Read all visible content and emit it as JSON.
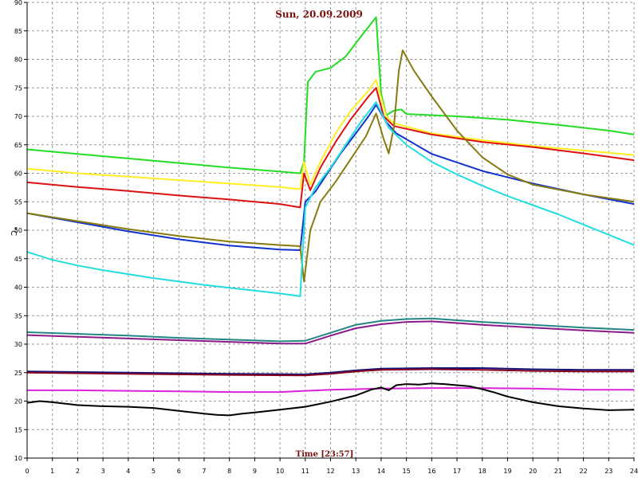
{
  "chart_data": {
    "type": "line",
    "title": "Sun, 20.09.2009",
    "xlabel": "Time [23:57]",
    "ylabel": "°C",
    "xlim": [
      0,
      24
    ],
    "ylim": [
      10,
      90
    ],
    "xticks": [
      "0",
      "1",
      "2",
      "3",
      "4",
      "5",
      "6",
      "7",
      "8",
      "9",
      "10",
      "11",
      "12",
      "13",
      "14",
      "15",
      "16",
      "17",
      "18",
      "19",
      "20",
      "21",
      "22",
      "23",
      "24"
    ],
    "yticks": [
      "10",
      "15",
      "20",
      "25",
      "30",
      "35",
      "40",
      "45",
      "50",
      "55",
      "60",
      "65",
      "70",
      "75",
      "80",
      "85",
      "90"
    ],
    "grid": true,
    "series": [
      {
        "color": "#22dd22",
        "points": [
          [
            0,
            64.2
          ],
          [
            2,
            63.4
          ],
          [
            4,
            62.6
          ],
          [
            6,
            61.8
          ],
          [
            8,
            61.0
          ],
          [
            10,
            60.3
          ],
          [
            10.8,
            60.0
          ],
          [
            10.95,
            62
          ],
          [
            11.1,
            76
          ],
          [
            11.4,
            77.8
          ],
          [
            12,
            78.5
          ],
          [
            12.6,
            80.5
          ],
          [
            13.2,
            84
          ],
          [
            13.8,
            87.4
          ],
          [
            14.0,
            74
          ],
          [
            14.2,
            70.2
          ],
          [
            14.5,
            71.0
          ],
          [
            14.8,
            71.2
          ],
          [
            15,
            70.4
          ],
          [
            17,
            70.0
          ],
          [
            19,
            69.4
          ],
          [
            21,
            68.5
          ],
          [
            23,
            67.5
          ],
          [
            24,
            66.8
          ]
        ]
      },
      {
        "color": "#ffee22",
        "points": [
          [
            0,
            60.8
          ],
          [
            2,
            60.0
          ],
          [
            4,
            59.4
          ],
          [
            6,
            58.8
          ],
          [
            8,
            58.2
          ],
          [
            10,
            57.6
          ],
          [
            10.8,
            57.2
          ],
          [
            10.95,
            62
          ],
          [
            11.2,
            58
          ],
          [
            11.6,
            62
          ],
          [
            12.2,
            67
          ],
          [
            12.8,
            71
          ],
          [
            13.5,
            74.5
          ],
          [
            13.8,
            76.4
          ],
          [
            14.2,
            70
          ],
          [
            14.5,
            68.8
          ],
          [
            16,
            67.0
          ],
          [
            18,
            65.8
          ],
          [
            20,
            64.8
          ],
          [
            22,
            64.0
          ],
          [
            24,
            63.2
          ]
        ]
      },
      {
        "color": "#dd1111",
        "points": [
          [
            0,
            58.4
          ],
          [
            2,
            57.6
          ],
          [
            4,
            56.9
          ],
          [
            6,
            56.1
          ],
          [
            8,
            55.4
          ],
          [
            10,
            54.6
          ],
          [
            10.8,
            54.0
          ],
          [
            10.95,
            60
          ],
          [
            11.2,
            57
          ],
          [
            11.6,
            61
          ],
          [
            12.2,
            65.5
          ],
          [
            12.8,
            69.5
          ],
          [
            13.5,
            73.5
          ],
          [
            13.8,
            75.0
          ],
          [
            14.1,
            70
          ],
          [
            14.5,
            68.3
          ],
          [
            16,
            66.8
          ],
          [
            18,
            65.5
          ],
          [
            20,
            64.6
          ],
          [
            22,
            63.5
          ],
          [
            24,
            62.3
          ]
        ]
      },
      {
        "color": "#1133cc",
        "points": [
          [
            0,
            53.0
          ],
          [
            2,
            51.4
          ],
          [
            4,
            49.8
          ],
          [
            6,
            48.4
          ],
          [
            8,
            47.3
          ],
          [
            10,
            46.6
          ],
          [
            10.8,
            46.5
          ],
          [
            11.0,
            55
          ],
          [
            11.4,
            56.8
          ],
          [
            11.8,
            59.5
          ],
          [
            12.4,
            63.5
          ],
          [
            13.0,
            67
          ],
          [
            13.5,
            70
          ],
          [
            13.8,
            72
          ],
          [
            14.2,
            69
          ],
          [
            14.6,
            67.0
          ],
          [
            16,
            63.4
          ],
          [
            18,
            60.4
          ],
          [
            20,
            58.2
          ],
          [
            22,
            56.3
          ],
          [
            24,
            54.6
          ]
        ]
      },
      {
        "color": "#877a10",
        "points": [
          [
            0,
            53.0
          ],
          [
            2,
            51.6
          ],
          [
            4,
            50.2
          ],
          [
            6,
            49.0
          ],
          [
            8,
            48.0
          ],
          [
            10,
            47.4
          ],
          [
            10.8,
            47.2
          ],
          [
            10.95,
            41
          ],
          [
            11.2,
            50
          ],
          [
            11.6,
            55
          ],
          [
            12.2,
            58.5
          ],
          [
            12.8,
            62.5
          ],
          [
            13.4,
            66.5
          ],
          [
            13.8,
            70.5
          ],
          [
            14.1,
            66
          ],
          [
            14.3,
            63.5
          ],
          [
            14.5,
            68
          ],
          [
            14.7,
            78
          ],
          [
            14.85,
            81.6
          ],
          [
            15.3,
            78
          ],
          [
            16,
            73.5
          ],
          [
            17,
            67.5
          ],
          [
            18,
            62.8
          ],
          [
            19,
            59.8
          ],
          [
            20,
            58.0
          ],
          [
            22,
            56.3
          ],
          [
            24,
            55.0
          ]
        ]
      },
      {
        "color": "#22dddd",
        "points": [
          [
            0,
            46.2
          ],
          [
            1,
            44.8
          ],
          [
            2,
            43.8
          ],
          [
            3,
            43.0
          ],
          [
            4,
            42.3
          ],
          [
            5,
            41.6
          ],
          [
            6,
            41.0
          ],
          [
            7,
            40.4
          ],
          [
            8,
            39.9
          ],
          [
            9,
            39.4
          ],
          [
            10,
            38.9
          ],
          [
            10.8,
            38.4
          ],
          [
            11.0,
            54
          ],
          [
            11.4,
            57.5
          ],
          [
            12,
            61
          ],
          [
            12.6,
            65
          ],
          [
            13.2,
            69
          ],
          [
            13.8,
            72.5
          ],
          [
            14.3,
            68
          ],
          [
            15,
            65
          ],
          [
            16,
            62
          ],
          [
            17,
            59.8
          ],
          [
            18,
            57.8
          ],
          [
            19,
            56.0
          ],
          [
            20,
            54.4
          ],
          [
            21,
            52.8
          ],
          [
            22,
            51.0
          ],
          [
            23,
            49.2
          ],
          [
            24,
            47.4
          ]
        ]
      },
      {
        "color": "#238585",
        "points": [
          [
            0,
            32.1
          ],
          [
            2,
            31.8
          ],
          [
            4,
            31.5
          ],
          [
            6,
            31.1
          ],
          [
            8,
            30.8
          ],
          [
            10,
            30.5
          ],
          [
            11,
            30.6
          ],
          [
            12,
            32.0
          ],
          [
            13,
            33.4
          ],
          [
            14,
            34.1
          ],
          [
            15,
            34.4
          ],
          [
            16,
            34.5
          ],
          [
            17,
            34.2
          ],
          [
            18,
            33.9
          ],
          [
            20,
            33.4
          ],
          [
            22,
            32.9
          ],
          [
            24,
            32.5
          ]
        ]
      },
      {
        "color": "#8a1a8a",
        "points": [
          [
            0,
            31.6
          ],
          [
            2,
            31.3
          ],
          [
            4,
            31.0
          ],
          [
            6,
            30.7
          ],
          [
            8,
            30.4
          ],
          [
            10,
            30.1
          ],
          [
            11,
            30.1
          ],
          [
            12,
            31.5
          ],
          [
            13,
            32.8
          ],
          [
            14,
            33.5
          ],
          [
            15,
            33.9
          ],
          [
            16,
            34.0
          ],
          [
            17,
            33.7
          ],
          [
            18,
            33.4
          ],
          [
            20,
            32.9
          ],
          [
            22,
            32.4
          ],
          [
            24,
            32.0
          ]
        ]
      },
      {
        "color": "#111177",
        "points": [
          [
            0,
            25.2
          ],
          [
            4,
            25.0
          ],
          [
            8,
            24.8
          ],
          [
            11,
            24.7
          ],
          [
            12,
            25.0
          ],
          [
            13,
            25.4
          ],
          [
            14,
            25.7
          ],
          [
            16,
            25.8
          ],
          [
            18,
            25.8
          ],
          [
            20,
            25.6
          ],
          [
            22,
            25.5
          ],
          [
            24,
            25.5
          ]
        ]
      },
      {
        "color": "#880020",
        "points": [
          [
            0,
            25.0
          ],
          [
            4,
            24.8
          ],
          [
            8,
            24.6
          ],
          [
            11,
            24.5
          ],
          [
            12,
            24.8
          ],
          [
            13,
            25.2
          ],
          [
            14,
            25.5
          ],
          [
            16,
            25.6
          ],
          [
            18,
            25.5
          ],
          [
            20,
            25.3
          ],
          [
            22,
            25.2
          ],
          [
            24,
            25.2
          ]
        ]
      },
      {
        "color": "#dd22dd",
        "points": [
          [
            0,
            21.9
          ],
          [
            2,
            21.9
          ],
          [
            4,
            21.8
          ],
          [
            6,
            21.7
          ],
          [
            8,
            21.6
          ],
          [
            10,
            21.6
          ],
          [
            11,
            21.8
          ],
          [
            12,
            22.0
          ],
          [
            14,
            22.2
          ],
          [
            16,
            22.3
          ],
          [
            18,
            22.3
          ],
          [
            20,
            22.2
          ],
          [
            22,
            22.0
          ],
          [
            24,
            22.0
          ]
        ]
      },
      {
        "color": "#000000",
        "points": [
          [
            0,
            19.7
          ],
          [
            0.5,
            20.0
          ],
          [
            1,
            19.8
          ],
          [
            2,
            19.3
          ],
          [
            3,
            19.1
          ],
          [
            4,
            19.0
          ],
          [
            5,
            18.8
          ],
          [
            6,
            18.3
          ],
          [
            7,
            17.8
          ],
          [
            7.5,
            17.6
          ],
          [
            8,
            17.5
          ],
          [
            8.5,
            17.8
          ],
          [
            9,
            18.0
          ],
          [
            10,
            18.5
          ],
          [
            11,
            19.0
          ],
          [
            12,
            19.9
          ],
          [
            13,
            21.0
          ],
          [
            13.6,
            22.0
          ],
          [
            14,
            22.4
          ],
          [
            14.3,
            21.9
          ],
          [
            14.6,
            22.8
          ],
          [
            15,
            23.0
          ],
          [
            15.5,
            22.9
          ],
          [
            16,
            23.1
          ],
          [
            16.5,
            23.0
          ],
          [
            17,
            22.8
          ],
          [
            17.5,
            22.6
          ],
          [
            18,
            22.1
          ],
          [
            18.5,
            21.5
          ],
          [
            19,
            20.8
          ],
          [
            20,
            19.8
          ],
          [
            21,
            19.1
          ],
          [
            22,
            18.7
          ],
          [
            23,
            18.4
          ],
          [
            24,
            18.5
          ]
        ]
      }
    ]
  }
}
